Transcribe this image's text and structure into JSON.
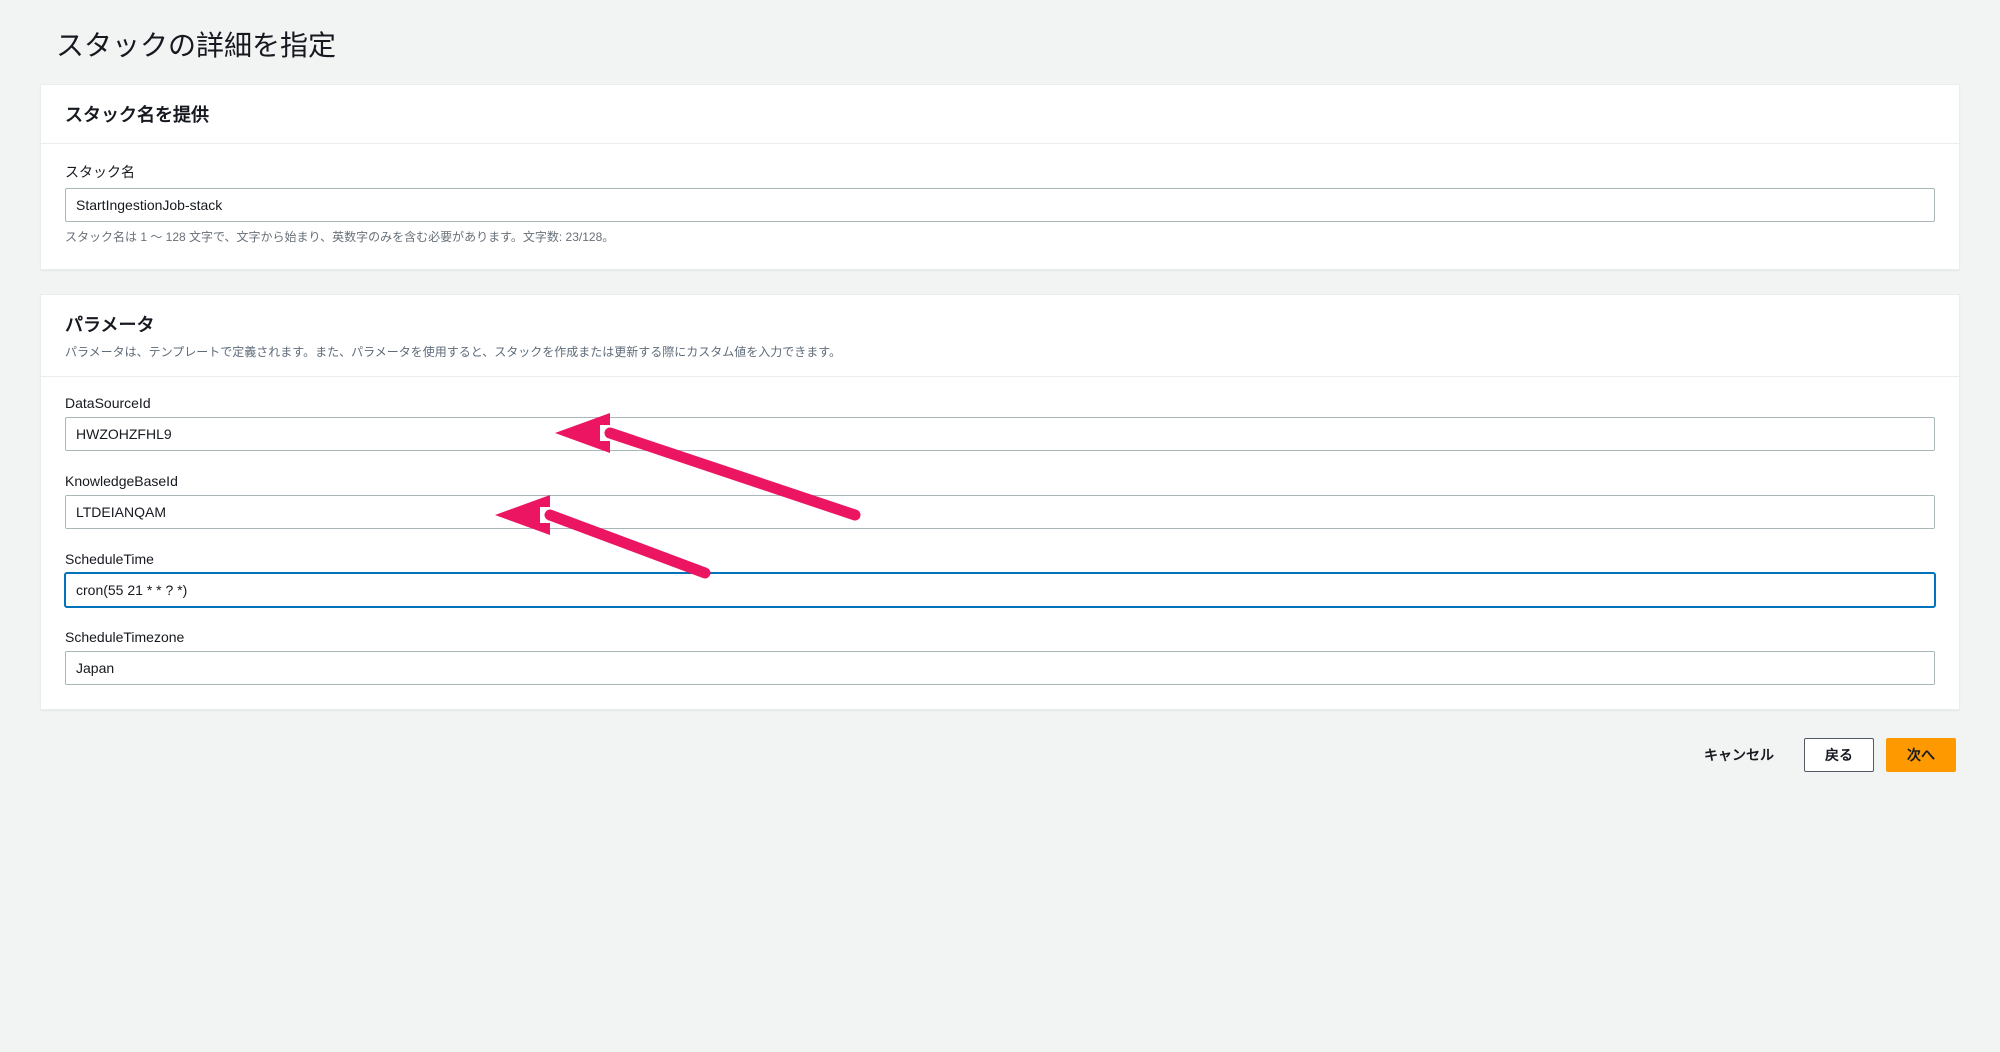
{
  "page_title": "スタックの詳細を指定",
  "stack_panel": {
    "header": "スタック名を提供",
    "label": "スタック名",
    "value": "StartIngestionJob-stack",
    "hint": "スタック名は 1 ～ 128 文字で、文字から始まり、英数字のみを含む必要があります。文字数: 23/128。"
  },
  "params_panel": {
    "header": "パラメータ",
    "sub": "パラメータは、テンプレートで定義されます。また、パラメータを使用すると、スタックを作成または更新する際にカスタム値を入力できます。",
    "fields": [
      {
        "label": "DataSourceId",
        "value": "HWZOHZFHL9",
        "focused": false
      },
      {
        "label": "KnowledgeBaseId",
        "value": "LTDEIANQAM",
        "focused": false
      },
      {
        "label": "ScheduleTime",
        "value": "cron(55 21 * * ? *)",
        "focused": true
      },
      {
        "label": "ScheduleTimezone",
        "value": "Japan",
        "focused": false
      }
    ]
  },
  "footer": {
    "cancel": "キャンセル",
    "back": "戻る",
    "next": "次へ"
  }
}
